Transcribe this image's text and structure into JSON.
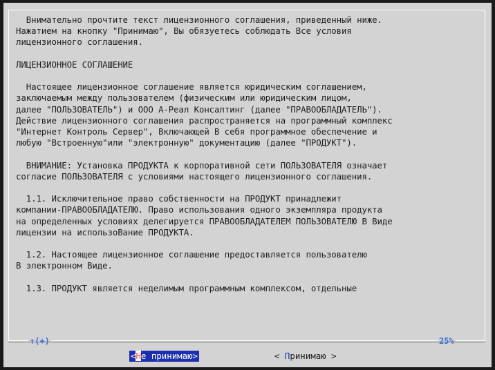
{
  "license_text": [
    "  Внимательно прочтите текст лицензионного соглашения, приведенный ниже.",
    "Нажатием на кнопку \"Принимаю\", Вы обязуетесь соблюдать Все условия",
    "лицензионного соглашения.",
    "",
    "ЛИЦЕНЗИОННОЕ СОГЛАШЕНИЕ",
    "",
    "  Настоящее лицензионное соглашение является юридическим соглашением,",
    "заключаемым между пользователем (физическим или юридическим лицом,",
    "далее \"ПОЛЬЗОВАТЕЛЬ\") и ООО А-Реал Консалтинг (далее \"ПРАВООБЛАДАТЕЛЬ\").",
    "Действие лицензионного соглашения распространяется на программный комплекс",
    "\"Интернет Контроль Сервер\", Включающей В себя программное обеспечение и",
    "любую \"Встроенную\"или \"электронную\" документацию (далее \"ПРОДУКТ\").",
    "",
    "  ВНИМАНИЕ: Установка ПРОДУКТА к корпоративной сети ПОЛЬЗОВАТЕЛЯ означает",
    "согласие ПОЛЬЗОВАТЕЛЯ с условиями настоящего лицензионного соглашения.",
    "",
    "  1.1. Исключительное право собственности на ПРОДУКТ принадлежит",
    "компании-ПРАВООБЛАДАТЕЛЮ. Право использования одного экземпляра продукта",
    "на определенных условиях делегируется ПРАВООБЛАДАТЕЛЕМ ПОЛЬЗОВАТЕЛЮ В Виде",
    "лицензии на использоВание ПРОДУКТА.",
    "",
    "  1.2. Настоящее лицензионное соглашение предоставляется пользователю",
    "В электронном Виде.",
    "",
    "  1.3. ПРОДУКТ является неделимым программным комплексом, отдельные"
  ],
  "scroll": {
    "up_indicator": "↑(+)",
    "percent": "25%"
  },
  "buttons": {
    "decline": {
      "prefix": "<",
      "hotkey": "Н",
      "rest": "е принимаю",
      "suffix": ">"
    },
    "accept": {
      "prefix": "< ",
      "hotkey": "П",
      "rest": "ринимаю",
      "suffix": " >"
    }
  },
  "colors": {
    "background": "#d3d3d3",
    "focused_button": "#1c2fae",
    "scroll_indicator": "#3b6fd6"
  }
}
